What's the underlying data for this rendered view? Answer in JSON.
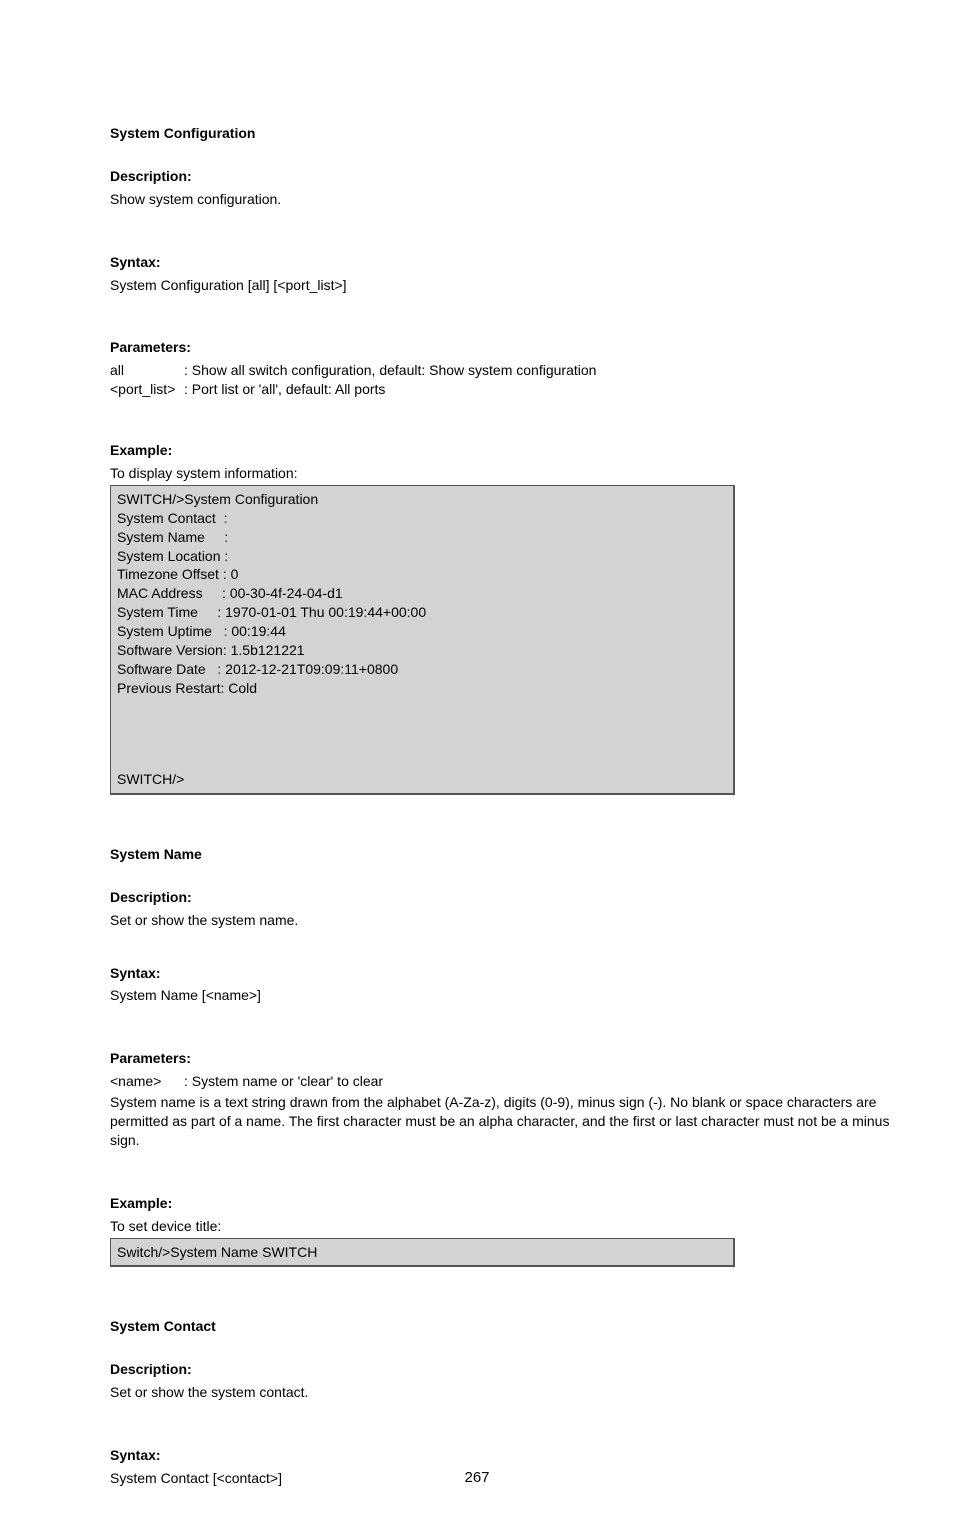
{
  "sysConfig": {
    "title": "System Configuration",
    "descLabel": "Description:",
    "descText": "Show system configuration.",
    "syntaxLabel": "Syntax:",
    "syntaxText": "System Configuration [all] [<port_list>]",
    "paramsLabel": "Parameters:",
    "params": [
      {
        "key": "all",
        "desc": ": Show all switch configuration, default: Show system configuration"
      },
      {
        "key": "<port_list>",
        "desc": ": Port list or 'all', default: All ports"
      }
    ],
    "exampleLabel": "Example:",
    "exampleLead": "To display system information:",
    "terminal": {
      "lines": [
        "SWITCH/>System Configuration",
        "System Contact  :",
        "System Name     :",
        "System Location :",
        "Timezone Offset : 0",
        "MAC Address     : 00-30-4f-24-04-d1",
        "System Time     : 1970-01-01 Thu 00:19:44+00:00",
        "System Uptime   : 00:19:44",
        "Software Version: 1.5b121221",
        "Software Date   : 2012-12-21T09:09:11+0800",
        "Previous Restart: Cold",
        "",
        "SWITCH/>"
      ]
    }
  },
  "sysName": {
    "title": "System Name",
    "descLabel": "Description:",
    "descText": "Set or show the system name.",
    "syntaxLabel": "Syntax:",
    "syntaxText": "System Name [<name>]",
    "paramsLabel": "Parameters:",
    "paramKey": "<name>",
    "paramDesc": ": System name or 'clear' to clear",
    "paramNote": "System name is a text string drawn from the alphabet (A-Za-z), digits (0-9), minus sign (-). No blank or space characters are permitted as part of a name. The first character must be an alpha character, and the first or last character must not be a minus sign.",
    "exampleLabel": "Example:",
    "exampleLead": "To set device title:",
    "terminalLine": "Switch/>System Name SWITCH"
  },
  "sysContact": {
    "title": "System Contact",
    "descLabel": "Description:",
    "descText": "Set or show the system contact.",
    "syntaxLabel": "Syntax:",
    "syntaxText": "System Contact [<contact>]"
  },
  "pageNumber": "267"
}
